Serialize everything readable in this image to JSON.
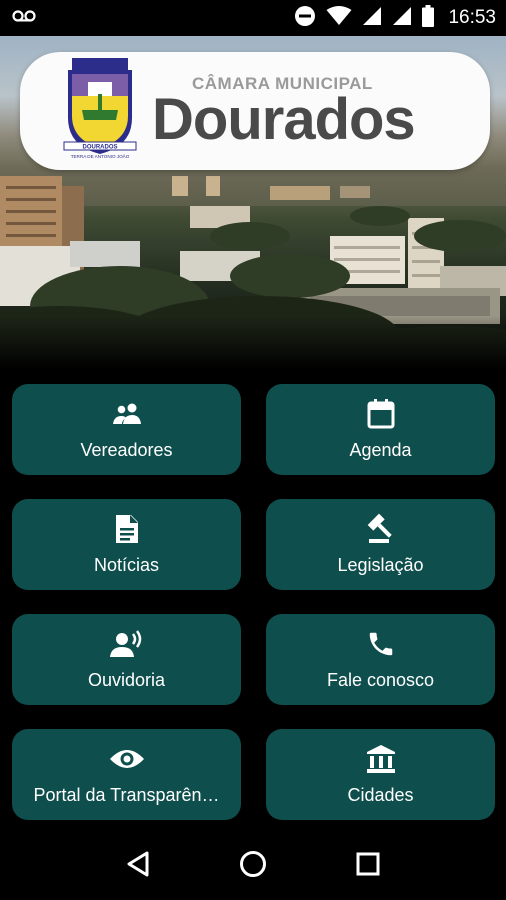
{
  "status_bar": {
    "time": "16:53",
    "icons": [
      "voicemail-icon",
      "do-not-disturb-icon",
      "wifi-icon",
      "signal-icon",
      "signal-icon",
      "battery-icon"
    ]
  },
  "header": {
    "subtitle": "CÂMARA MUNICIPAL",
    "title": "Dourados",
    "crest_text": "DOURADOS",
    "crest_motto": "TERRA DE ANTONIO JOÃO"
  },
  "menu": [
    {
      "label": "Vereadores",
      "icon": "people-icon"
    },
    {
      "label": "Agenda",
      "icon": "calendar-icon"
    },
    {
      "label": "Notícias",
      "icon": "document-icon"
    },
    {
      "label": "Legislação",
      "icon": "gavel-icon"
    },
    {
      "label": "Ouvidoria",
      "icon": "voice-icon"
    },
    {
      "label": "Fale conosco",
      "icon": "phone-icon"
    },
    {
      "label": "Portal da Transparên…",
      "icon": "eye-icon"
    },
    {
      "label": "Cidades",
      "icon": "bank-icon"
    }
  ],
  "nav": [
    "back-icon",
    "home-icon",
    "recents-icon"
  ],
  "colors": {
    "button": "#0e4e4c",
    "background": "#000000",
    "logo_text": "#4a4a4a"
  }
}
